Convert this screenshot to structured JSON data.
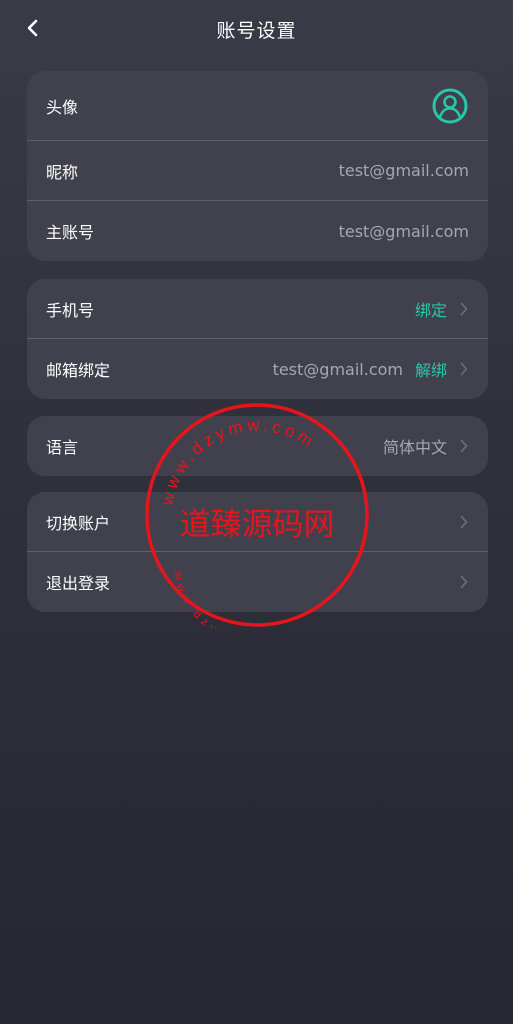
{
  "header": {
    "title": "账号设置"
  },
  "groups": [
    {
      "rows": [
        {
          "label": "头像"
        },
        {
          "label": "昵称",
          "value": "test@gmail.com"
        },
        {
          "label": "主账号",
          "value": "test@gmail.com"
        }
      ]
    },
    {
      "rows": [
        {
          "label": "手机号",
          "action": "绑定"
        },
        {
          "label": "邮箱绑定",
          "value": "test@gmail.com",
          "action": "解绑"
        }
      ]
    },
    {
      "rows": [
        {
          "label": "语言",
          "value": "简体中文"
        }
      ]
    },
    {
      "rows": [
        {
          "label": "切换账户"
        },
        {
          "label": "退出登录"
        }
      ]
    }
  ],
  "watermark": {
    "main_text": "道臻源码网",
    "ring_text": "www.dzymw.com"
  },
  "colors": {
    "accent": "#27c7a8",
    "card": "#40414d",
    "value_text": "#a4a8b3",
    "stamp": "#e8141c"
  },
  "icons": {
    "back": "chevron-left-icon",
    "avatar": "user-circle-icon",
    "row_arrow": "chevron-right-icon"
  }
}
